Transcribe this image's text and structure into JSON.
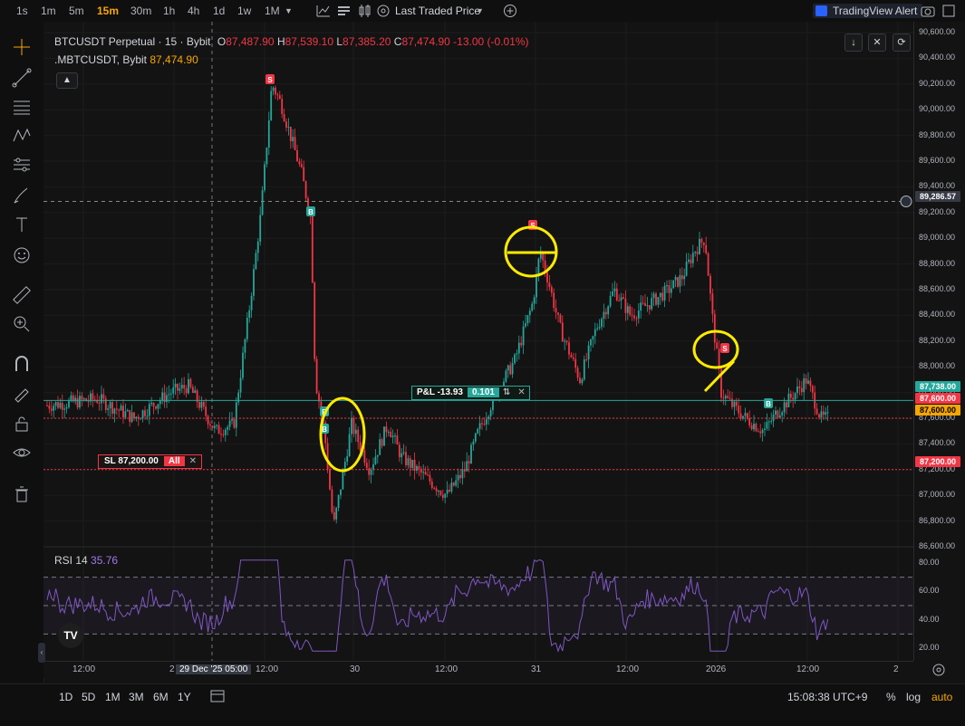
{
  "toolbar": {
    "timeframes": [
      "1s",
      "1m",
      "5m",
      "15m",
      "30m",
      "1h",
      "4h",
      "1d",
      "1w",
      "1M"
    ],
    "active_timeframe": "15m",
    "price_source": "Last Traded Price",
    "alert_button": "TradingView Alert"
  },
  "legend": {
    "symbol": "BTCUSDT Perpetual · 15 · Bybit",
    "open_label": "O",
    "open": "87,487.90",
    "high_label": "H",
    "high": "87,539.10",
    "low_label": "L",
    "low": "87,385.20",
    "close_label": "C",
    "close": "87,474.90",
    "change": "-13.00 (-0.01%)",
    "mark_symbol": ".MBTCUSDT, Bybit",
    "mark_price": "87,474.90"
  },
  "price_axis": {
    "labels": [
      "90,600.00",
      "90,400.00",
      "90,200.00",
      "90,000.00",
      "89,800.00",
      "89,600.00",
      "89,400.00",
      "89,200.00",
      "89,000.00",
      "88,800.00",
      "88,600.00",
      "88,400.00",
      "88,200.00",
      "88,000.00",
      "87,800.00",
      "87,600.00",
      "87,400.00",
      "87,200.00",
      "87,000.00",
      "86,800.00",
      "86,600.00"
    ],
    "crosshair_price": "89,286.57",
    "tag_green": "87,738.00",
    "tag_red": "87,600.00",
    "tag_orange": "87,600.00",
    "tag_sl": "87,200.00",
    "rsi_labels": [
      "80.00",
      "60.00",
      "40.00",
      "20.00"
    ]
  },
  "orders": {
    "sl_text": "SL 87,200.00",
    "sl_qty": "All",
    "pnl_text": "P&L -13.93",
    "pnl_qty": "0.101"
  },
  "markers": {
    "sell": "S",
    "buy": "B"
  },
  "rsi": {
    "label": "RSI 14",
    "value": "35.76"
  },
  "time_axis": {
    "labels": [
      "12:00",
      "2",
      "12:00",
      "30",
      "12:00",
      "31",
      "12:00",
      "2026",
      "12:00",
      "2"
    ],
    "crosshair_time": "29 Dec '25   05:00"
  },
  "bottom": {
    "ranges": [
      "1D",
      "5D",
      "1M",
      "3M",
      "6M",
      "1Y"
    ],
    "clock": "15:08:38 UTC+9",
    "percent": "%",
    "log": "log",
    "auto": "auto"
  },
  "chart_data": {
    "type": "candlestick",
    "symbol": "BTCUSDT Perpetual",
    "timeframe": "15m",
    "x": [
      "28 Dec 12:00",
      "29 Dec 05:00",
      "29 Dec 12:00",
      "30",
      "30 Dec 12:00",
      "31",
      "31 Dec 12:00",
      "2026",
      "1 Jan 12:00"
    ],
    "close_approx": [
      87700,
      87500,
      90200,
      87100,
      87100,
      88900,
      88400,
      88000,
      87600
    ],
    "ylim": [
      86600,
      90600
    ],
    "horizontal_levels": {
      "crosshair": 89286.57,
      "position": 87738,
      "last": 87600,
      "stop_loss": 87200
    },
    "rsi_levels": [
      70,
      50,
      30
    ],
    "rsi_value": 35.76
  },
  "colors": {
    "up": "#26a69a",
    "down": "#f23645",
    "accent": "#f7a600",
    "rsi": "#7e57c2",
    "annotation": "#ffeb00"
  }
}
